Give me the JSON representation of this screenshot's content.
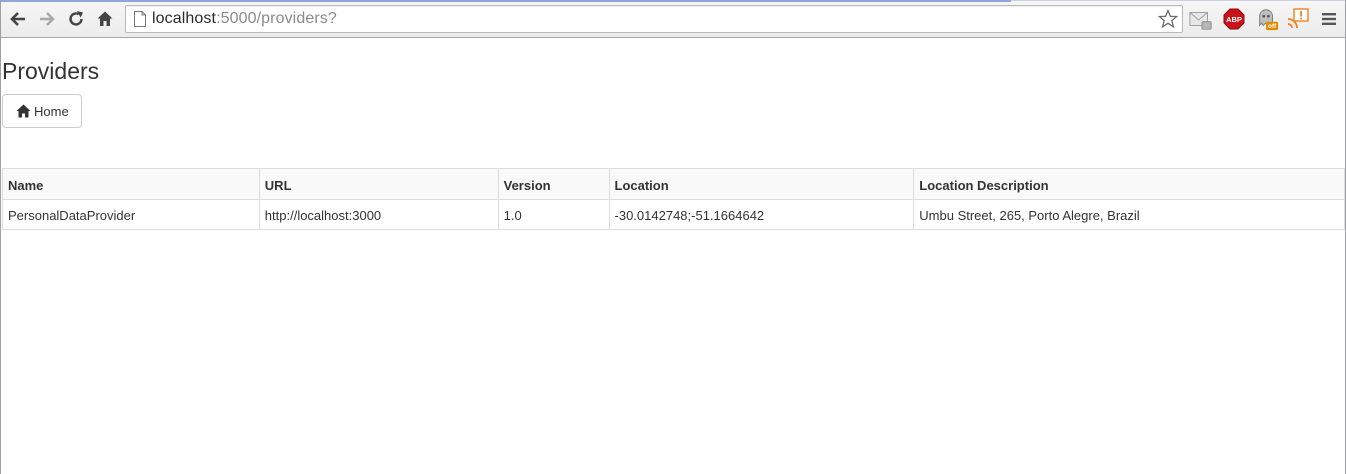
{
  "browser": {
    "url_host": "localhost",
    "url_rest": ":5000/providers?",
    "extensions": [
      {
        "icon": "mail-checker-icon"
      },
      {
        "icon": "adblock-plus-icon",
        "label": "ABP"
      },
      {
        "icon": "ghostery-icon",
        "badge": "off"
      },
      {
        "icon": "rss-alert-icon"
      },
      {
        "icon": "menu-icon"
      }
    ]
  },
  "page": {
    "title": "Providers",
    "home_button": "Home"
  },
  "table": {
    "headers": [
      "Name",
      "URL",
      "Version",
      "Location",
      "Location Description"
    ],
    "rows": [
      [
        "PersonalDataProvider",
        "http://localhost:3000",
        "1.0",
        "-30.0142748;-51.1664642",
        "Umbu Street, 265, Porto Alegre, Brazil"
      ]
    ]
  },
  "colors": {
    "abp_red": "#c7141a",
    "ghostery_badge": "#e08a00",
    "rss_orange": "#f08020",
    "table_border": "#dddddd"
  }
}
